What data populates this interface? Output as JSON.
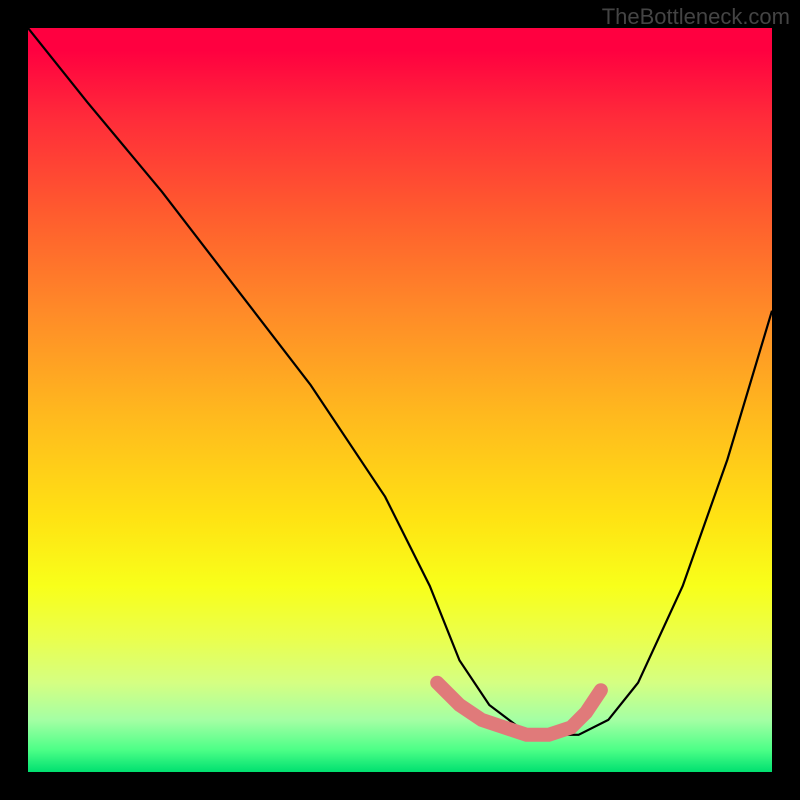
{
  "watermark": "TheBottleneck.com",
  "chart_data": {
    "type": "line",
    "title": "",
    "xlabel": "",
    "ylabel": "",
    "xlim": [
      0,
      100
    ],
    "ylim": [
      0,
      100
    ],
    "series": [
      {
        "name": "bottleneck-curve",
        "x": [
          0,
          8,
          18,
          28,
          38,
          48,
          54,
          58,
          62,
          66,
          70,
          74,
          78,
          82,
          88,
          94,
          100
        ],
        "values": [
          100,
          90,
          78,
          65,
          52,
          37,
          25,
          15,
          9,
          6,
          5,
          5,
          7,
          12,
          25,
          42,
          62
        ]
      },
      {
        "name": "optimal-band-start",
        "x": [
          55,
          58,
          61,
          64,
          67,
          70,
          73,
          75,
          77
        ],
        "values": [
          12,
          9,
          7,
          6,
          5,
          5,
          6,
          8,
          11
        ]
      }
    ],
    "colors": {
      "curve": "#000000",
      "optimal_band": "#e07a7a"
    }
  }
}
